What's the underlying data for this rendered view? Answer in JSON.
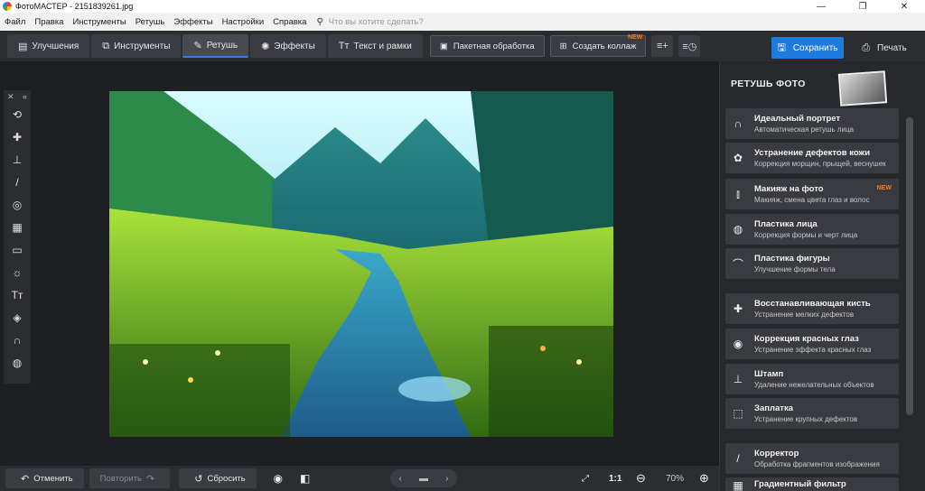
{
  "window": {
    "title": "ФотоМАСТЕР - 2151839261.jpg",
    "minimize": "—",
    "restore": "❐",
    "close": "✕"
  },
  "menu": {
    "items": [
      "Файл",
      "Правка",
      "Инструменты",
      "Ретушь",
      "Эффекты",
      "Настройки",
      "Справка"
    ],
    "search_placeholder": "Что вы хотите сделать?"
  },
  "toolbar": {
    "tabs": [
      {
        "label": "Улучшения",
        "icon": "▤"
      },
      {
        "label": "Инструменты",
        "icon": "⧉"
      },
      {
        "label": "Ретушь",
        "icon": "✎"
      },
      {
        "label": "Эффекты",
        "icon": "✺"
      },
      {
        "label": "Текст и рамки",
        "icon": "Tт"
      }
    ],
    "batch_label": "Пакетная обработка",
    "collage_label": "Создать коллаж",
    "collage_badge": "NEW",
    "save_label": "Сохранить",
    "print_label": "Печать"
  },
  "left_tools": {
    "header_close": "✕",
    "header_collapse": "«"
  },
  "panel": {
    "title": "РЕТУШЬ ФОТО",
    "cards": [
      {
        "title": "Идеальный портрет",
        "subtitle": "Автоматическая ретушь лица",
        "icon": "face-icon"
      },
      {
        "title": "Устранение дефектов кожи",
        "subtitle": "Коррекция морщин, прыщей, веснушек",
        "icon": "skin-icon"
      },
      {
        "title": "Макияж на фото",
        "subtitle": "Макияж, смена цвета глаз и волос",
        "icon": "makeup-icon",
        "badge": "NEW"
      },
      {
        "title": "Пластика лица",
        "subtitle": "Коррекция формы и черт лица",
        "icon": "face-shape-icon"
      },
      {
        "title": "Пластика фигуры",
        "subtitle": "Улучшение формы тела",
        "icon": "figure-icon"
      },
      {
        "title": "Восстанавливающая кисть",
        "subtitle": "Устранение мелких дефектов",
        "icon": "healing-brush-icon"
      },
      {
        "title": "Коррекция красных глаз",
        "subtitle": "Устранение эффекта красных глаз",
        "icon": "eye-icon"
      },
      {
        "title": "Штамп",
        "subtitle": "Удаление нежелательных объектов",
        "icon": "stamp-icon"
      },
      {
        "title": "Заплатка",
        "subtitle": "Устранение крупных дефектов",
        "icon": "patch-icon"
      },
      {
        "title": "Корректор",
        "subtitle": "Обработка фрагментов изображения",
        "icon": "brush-icon"
      },
      {
        "title": "Градиентный фильтр",
        "subtitle": "",
        "icon": "gradient-icon"
      }
    ]
  },
  "bottom": {
    "undo_label": "Отменить",
    "redo_label": "Повторить",
    "reset_label": "Сбросить",
    "fit_label": "1:1",
    "zoom_value": "70%"
  }
}
